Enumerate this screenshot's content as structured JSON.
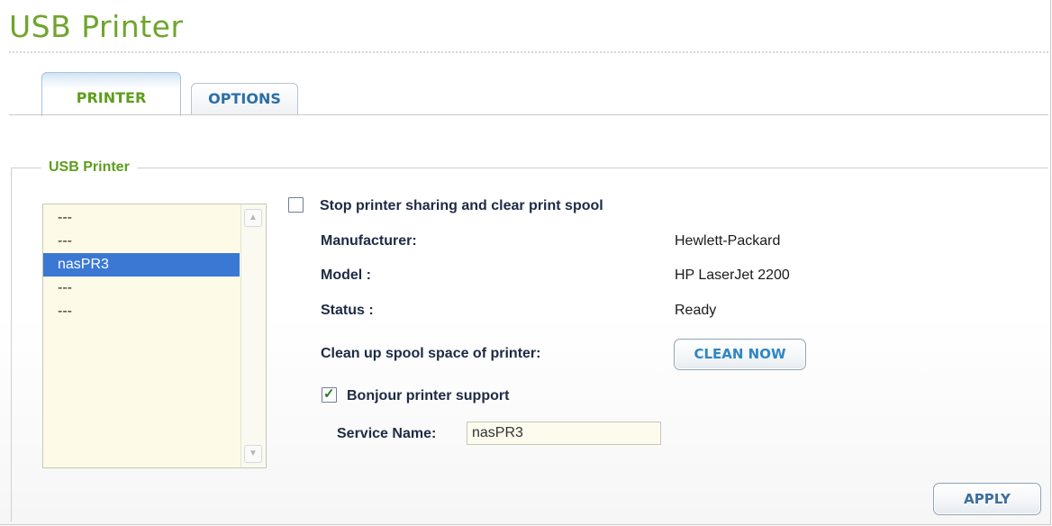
{
  "page": {
    "title": "USB Printer"
  },
  "tabs": [
    {
      "label": "PRINTER",
      "active": true
    },
    {
      "label": "OPTIONS",
      "active": false
    }
  ],
  "section": {
    "legend": "USB Printer"
  },
  "printer_list": {
    "items": [
      "---",
      "---",
      "nasPR3",
      "---",
      "---"
    ],
    "selected_index": 2
  },
  "stop_sharing": {
    "label": "Stop printer sharing and clear print spool",
    "checked": false
  },
  "details": {
    "manufacturer_label": "Manufacturer:",
    "manufacturer_value": "Hewlett-Packard",
    "model_label": "Model :",
    "model_value": "HP LaserJet 2200",
    "status_label": "Status :",
    "status_value": "Ready"
  },
  "cleanup": {
    "label": "Clean up spool space of printer:",
    "button_label": "CLEAN NOW"
  },
  "bonjour": {
    "label": "Bonjour printer support",
    "checked": true,
    "service_name_label": "Service Name:",
    "service_name_value": "nasPR3"
  },
  "apply": {
    "label": "APPLY"
  },
  "colors": {
    "title_green": "#6fa52c",
    "tab_blue": "#2a6fa8",
    "selected_blue": "#3a78d4",
    "button_text": "#2f86c4"
  },
  "icons": {
    "scroll_up": "chevron-up-icon",
    "scroll_down": "chevron-down-icon",
    "check": "checkmark-icon"
  }
}
